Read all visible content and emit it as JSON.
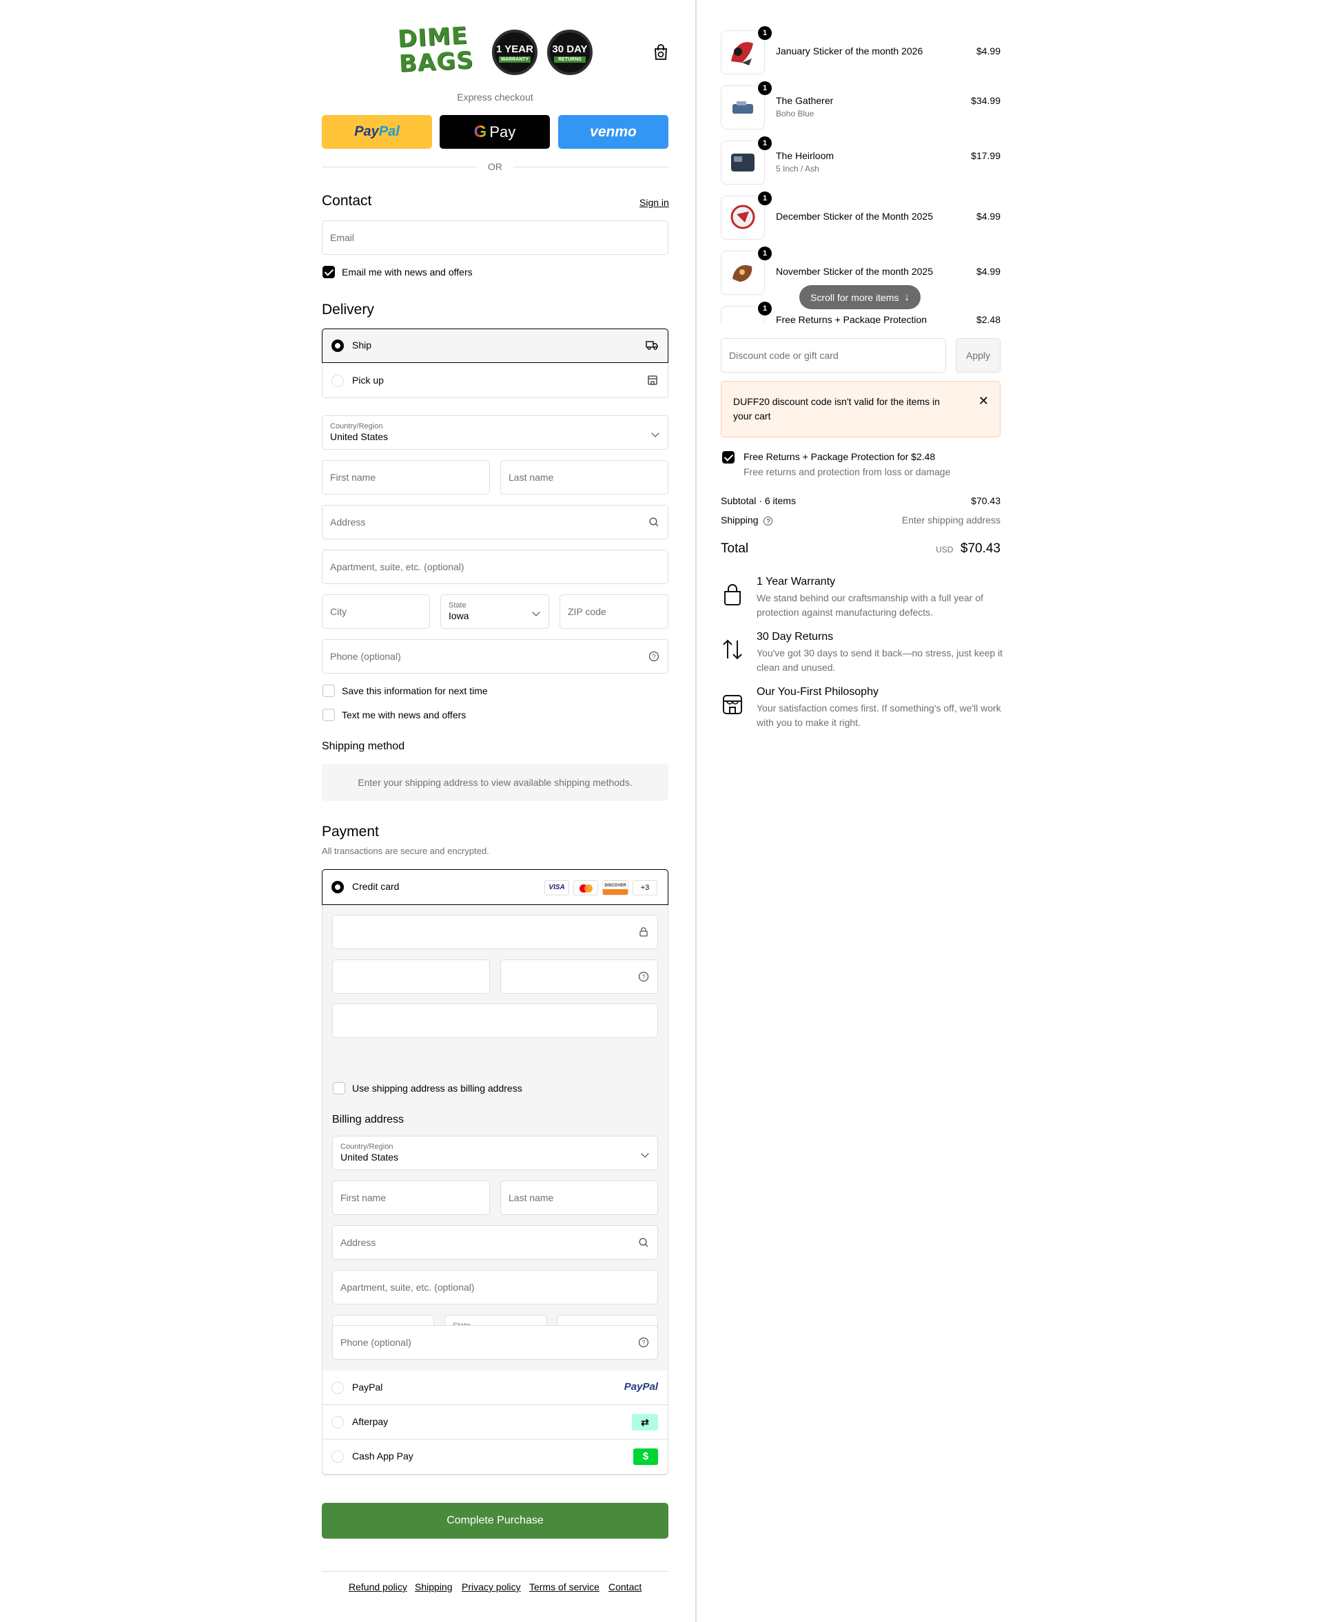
{
  "brand": {
    "logo_text": "DIME BAGS",
    "badge1_top": "1 YEAR",
    "badge1_sub": "WARRANTY",
    "badge2_top": "30 DAY",
    "badge2_sub": "RETURNS",
    "green": "#3f8b2e"
  },
  "express": {
    "label": "Express checkout",
    "paypal": [
      "Pay",
      "Pal"
    ],
    "gpay": "Pay",
    "venmo": "venmo",
    "or": "OR"
  },
  "contact": {
    "title": "Contact",
    "sign_in": "Sign in",
    "email_placeholder": "Email",
    "news_label": "Email me with news and offers"
  },
  "delivery": {
    "title": "Delivery",
    "ship": "Ship",
    "pickup": "Pick up",
    "country_label": "Country/Region",
    "country_value": "United States",
    "first_name": "First name",
    "last_name": "Last name",
    "address": "Address",
    "apartment": "Apartment, suite, etc. (optional)",
    "city": "City",
    "state_label": "State",
    "state_value": "Iowa",
    "zip": "ZIP code",
    "phone": "Phone (optional)",
    "save_info": "Save this information for next time",
    "text_news": "Text me with news and offers"
  },
  "shipping_method": {
    "title": "Shipping method",
    "message": "Enter your shipping address to view available shipping methods."
  },
  "payment": {
    "title": "Payment",
    "subtitle": "All transactions are secure and encrypted.",
    "credit_card": "Credit card",
    "card_logos": [
      "VISA",
      "MC",
      "DISCOVER"
    ],
    "more": "+3",
    "use_shipping": "Use shipping address as billing address",
    "billing_title": "Billing address",
    "paypal": "PayPal",
    "paypal_logo": "PayPal",
    "afterpay": "Afterpay",
    "cashapp": "Cash App Pay",
    "complete": "Complete Purchase"
  },
  "footer": {
    "links": [
      "Refund policy",
      "Shipping",
      "Privacy policy",
      "Terms of service",
      "Contact"
    ]
  },
  "cart": {
    "items": [
      {
        "qty": "1",
        "name": "January Sticker of the month 2026",
        "variant": "",
        "price": "$4.99"
      },
      {
        "qty": "1",
        "name": "The Gatherer",
        "variant": "Boho Blue",
        "price": "$34.99"
      },
      {
        "qty": "1",
        "name": "The Heirloom",
        "variant": "5 Inch / Ash",
        "price": "$17.99"
      },
      {
        "qty": "1",
        "name": "December Sticker of the Month 2025",
        "variant": "",
        "price": "$4.99"
      },
      {
        "qty": "1",
        "name": "November Sticker of the month 2025",
        "variant": "",
        "price": "$4.99"
      },
      {
        "qty": "1",
        "name": "Free Returns + Package Protection",
        "variant": "",
        "price": "$2.48"
      }
    ],
    "scroll_hint": "Scroll for more items",
    "discount_placeholder": "Discount code or gift card",
    "apply": "Apply",
    "notice": "DUFF20 discount code isn't valid for the items in your cart",
    "protection_label": "Free Returns + Package Protection for $2.48",
    "protection_desc": "Free returns and protection from loss or damage",
    "subtotal_label": "Subtotal · 6 items",
    "subtotal_value": "$70.43",
    "shipping_label": "Shipping",
    "shipping_value": "Enter shipping address",
    "total_label": "Total",
    "currency": "USD",
    "total_value": "$70.43"
  },
  "features": [
    {
      "title": "1 Year Warranty",
      "desc": "We stand behind our craftsmanship with a full year of protection against manufacturing defects.",
      "icon": "bag-icon"
    },
    {
      "title": "30 Day Returns",
      "desc": "You've got 30 days to send it back—no stress, just keep it clean and unused.",
      "icon": "swap-arrows-icon"
    },
    {
      "title": "Our You-First Philosophy",
      "desc": "Your satisfaction comes first. If something's off, we'll work with you to make it right.",
      "icon": "storefront-icon"
    }
  ],
  "colors": {
    "accent": "#4a8a3c",
    "border": "#dedede",
    "muted": "#707070",
    "notice_bg": "#fff3ea"
  }
}
